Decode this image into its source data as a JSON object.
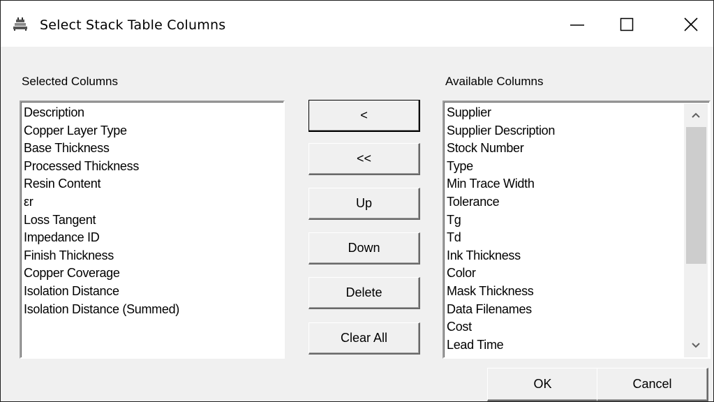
{
  "window": {
    "title": "Select Stack Table Columns",
    "icon": "stack-table-icon",
    "controls": [
      "minimize-icon",
      "maximize-icon",
      "close-icon"
    ]
  },
  "selected": {
    "label": "Selected Columns",
    "items": [
      "Description",
      "Copper Layer Type",
      "Base Thickness",
      "Processed Thickness",
      "Resin Content",
      "εr",
      "Loss Tangent",
      "Impedance ID",
      "Finish Thickness",
      "Copper Coverage",
      "Isolation Distance",
      "Isolation Distance (Summed)"
    ]
  },
  "available": {
    "label": "Available Columns",
    "items": [
      "Supplier",
      "Supplier Description",
      "Stock Number",
      "Type",
      "Min Trace Width",
      "Tolerance",
      "Tg",
      "Td",
      "Ink Thickness",
      "Color",
      "Mask Thickness",
      "Data Filenames",
      "Cost",
      "Lead Time"
    ]
  },
  "buttons": {
    "add": "<",
    "add_all": "<<",
    "up": "Up",
    "down": "Down",
    "delete": "Delete",
    "clear_all": "Clear All",
    "ok": "OK",
    "cancel": "Cancel"
  }
}
